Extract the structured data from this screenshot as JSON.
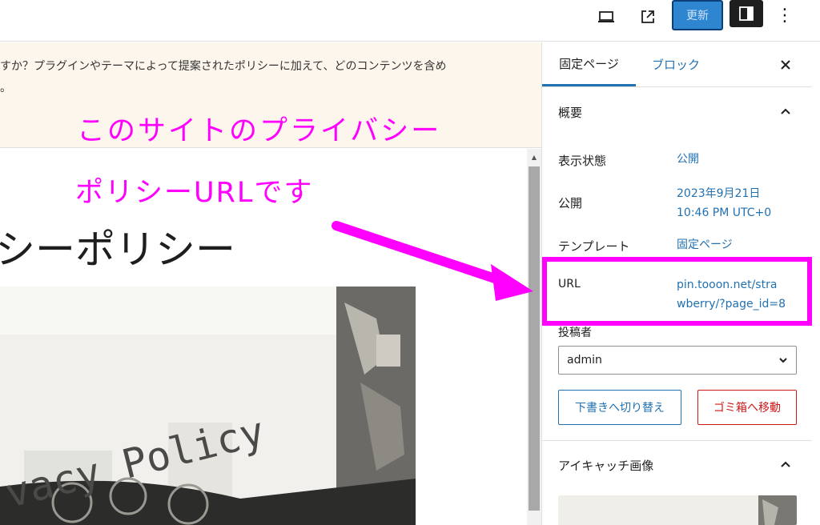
{
  "toolbar": {
    "update_label": "更新"
  },
  "notice": {
    "text": "すか？プラグインやテーマによって提案されたポリシーに加えて、どのコンテンツを含め",
    "tail": "。"
  },
  "editor": {
    "page_title": "シーポリシー",
    "image_text": "vacy Policy"
  },
  "sidebar": {
    "tabs": [
      {
        "label": "固定ページ"
      },
      {
        "label": "ブロック"
      }
    ],
    "summary": {
      "title": "概要",
      "rows": [
        {
          "label": "表示状態",
          "value": "公開"
        },
        {
          "label": "公開",
          "value": "2023年9月21日",
          "value2": "10:46 PM UTC+0"
        },
        {
          "label": "テンプレート",
          "value": "固定ページ"
        },
        {
          "label": "URL",
          "value": "pin.tooon.net/stra",
          "value2": "wberry/?page_id=8"
        }
      ],
      "author_label": "投稿者",
      "author_value": "admin",
      "draft_button": "下書きへ切り替え",
      "trash_button": "ゴミ箱へ移動"
    },
    "featured": {
      "title": "アイキャッチ画像"
    }
  },
  "annotation": {
    "line1": "このサイトのプライバシー",
    "line2": "ポリシーURLです",
    "color": "#ff00ff"
  },
  "colors": {
    "accent": "#2271b1",
    "danger": "#cc1818",
    "notice_bg": "#fdf6ec"
  }
}
